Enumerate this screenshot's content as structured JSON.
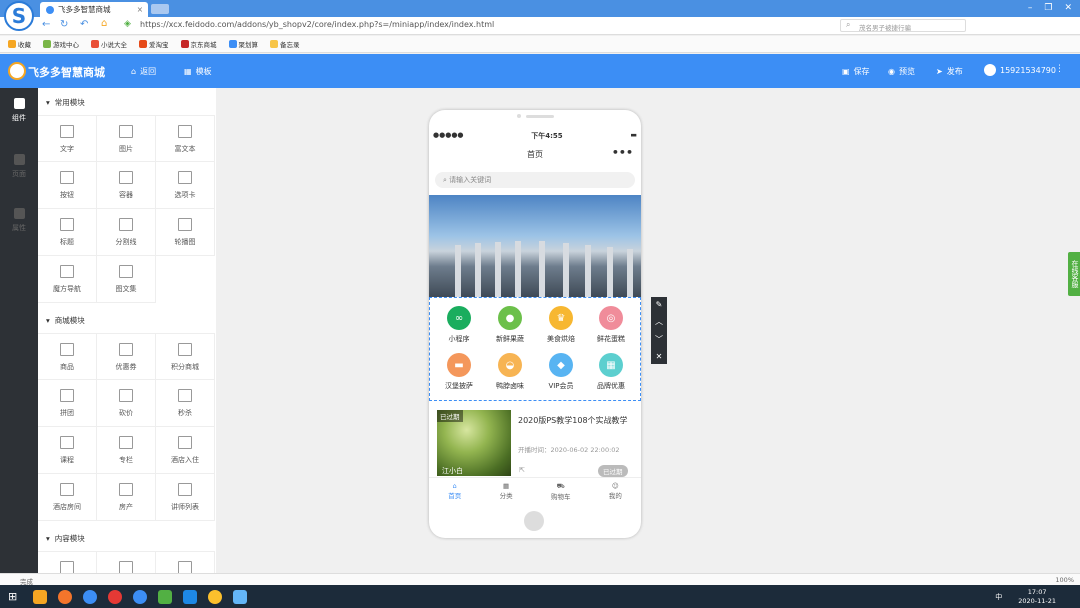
{
  "browser": {
    "tab_title": "飞多多智慧商城",
    "url": "https://xcx.feidodo.com/addons/yb_shopv2/core/index.php?s=/miniapp/index/index.html",
    "search_placeholder": "茂名男子被捷行骗",
    "status_text": "完成",
    "zoom": "100%",
    "taskbar_time": "17:07",
    "taskbar_date": "2020-11-21",
    "ime": "中",
    "bookmarks": [
      "收藏",
      "游戏中心",
      "小说大全",
      "爱淘宝",
      "京东商城",
      "聚划算",
      "备忘录"
    ]
  },
  "app": {
    "title": "飞多多智慧商城",
    "back_label": "返回",
    "template_label": "模板",
    "save_label": "保存",
    "preview_label": "预览",
    "publish_label": "发布",
    "user_phone": "15921534790",
    "rail": [
      "组件",
      "页面",
      "属性"
    ]
  },
  "sections": [
    {
      "title": "常用模块",
      "items": [
        "文字",
        "图片",
        "富文本",
        "按钮",
        "容器",
        "选项卡",
        "标题",
        "分割线",
        "轮播图",
        "魔方导航",
        "图文集"
      ]
    },
    {
      "title": "商城模块",
      "items": [
        "商品",
        "优惠券",
        "积分商城",
        "拼团",
        "砍价",
        "秒杀",
        "课程",
        "专栏",
        "酒店入住",
        "酒店房间",
        "房产",
        "讲师列表"
      ]
    },
    {
      "title": "内容模块",
      "items": []
    }
  ],
  "phone": {
    "time": "下午4:55",
    "page_title": "首页",
    "search_placeholder": "请输入关键词",
    "grid": [
      {
        "label": "小程序",
        "color": "#1aad5e"
      },
      {
        "label": "新鲜果蔬",
        "color": "#6cc04a"
      },
      {
        "label": "美食烘焙",
        "color": "#f7b731"
      },
      {
        "label": "鲜花蛋糕",
        "color": "#f08c9a"
      },
      {
        "label": "汉堡披萨",
        "color": "#f4975b"
      },
      {
        "label": "鸭脖卤味",
        "color": "#f7b453"
      },
      {
        "label": "VIP会员",
        "color": "#58b4f2"
      },
      {
        "label": "品牌优惠",
        "color": "#5ccfcf"
      }
    ],
    "course": {
      "badge": "已过期",
      "title": "2020版PS教学108个实战教学",
      "time": "开播时间：2020-06-02 22:00:02",
      "teacher": "江小白",
      "status": "已过期"
    },
    "tabs": [
      "首页",
      "分类",
      "购物车",
      "我的"
    ]
  },
  "service_label": "在线客服"
}
